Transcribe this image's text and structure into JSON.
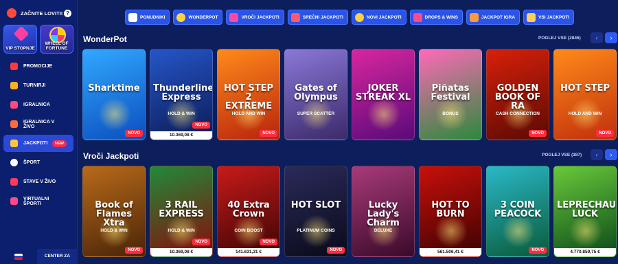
{
  "sidebar": {
    "start_text": "ZAČNITE LOVITI!",
    "promos": [
      {
        "label": "VIP STOPNJE"
      },
      {
        "label": "WHEEL OF FORTUNE"
      }
    ],
    "items": [
      {
        "label": "PROMOCIJE",
        "color": "#ff3a3a"
      },
      {
        "label": "TURNIRJI",
        "color": "#ffb020"
      },
      {
        "label": "IGRALNICA",
        "color": "#ff4a7a"
      },
      {
        "label": "IGRALNICA V ŽIVO",
        "color": "#ff6a3a"
      },
      {
        "label": "JACKPOTI",
        "color": "#ffc83a",
        "badge": "NEW"
      },
      {
        "label": "ŠPORT",
        "color": "#ffffff"
      },
      {
        "label": "STAVE V ŽIVO",
        "color": "#ff3a5a"
      },
      {
        "label": "VIRTUALNI ŠPORTI",
        "color": "#ff4a8a"
      }
    ],
    "center_label": "CENTER ZA"
  },
  "categories": [
    {
      "label": "PONUDNIKI",
      "color": "#ffffff"
    },
    {
      "label": "WONDERPOT",
      "color": "#ffd23a"
    },
    {
      "label": "VROČI JACKPOTI",
      "color": "#ff4aa0"
    },
    {
      "label": "SREČNI JACKPOTI",
      "color": "#ff5a6a"
    },
    {
      "label": "NOVI JACKPOTI",
      "color": "#ffd23a"
    },
    {
      "label": "DROPS & WINS",
      "color": "#ff4a8a"
    },
    {
      "label": "JACKPOT IGRA",
      "color": "#ff9a3a"
    },
    {
      "label": "VSI JACKPOTI",
      "color": "#ffcf5a"
    }
  ],
  "sections": [
    {
      "title": "WonderPot",
      "see_all": "POGLEJ VSE (2846)",
      "games": [
        {
          "title": "Sharktime",
          "bg1": "#31a8ff",
          "bg2": "#0b4fbf",
          "badge": "NOVO"
        },
        {
          "title": "Thunderline Express",
          "sub": "HOLD & WIN",
          "bg1": "#2456c8",
          "bg2": "#0c1b55",
          "badge": "NOVO",
          "jackpot": "10.369,08 €"
        },
        {
          "title": "HOT STEP 2 EXTREME",
          "sub": "HOLD AND WIN",
          "bg1": "#ff8a1a",
          "bg2": "#b8240c",
          "badge": "NOVO"
        },
        {
          "title": "Gates of Olympus",
          "sub": "SUPER SCATTER",
          "bg1": "#8a78d8",
          "bg2": "#3b2a6a"
        },
        {
          "title": "JOKER STREAK XL",
          "bg1": "#d8269e",
          "bg2": "#5a0a7a"
        },
        {
          "title": "Piñatas Festival",
          "sub": "BONUS",
          "bg1": "#ff6ab8",
          "bg2": "#2a8a3a"
        },
        {
          "title": "GOLDEN BOOK OF RA",
          "sub": "CASH CONNECTION",
          "bg1": "#d8200a",
          "bg2": "#5a0a04",
          "badge": "NOVO"
        },
        {
          "title": "HOT STEP",
          "sub": "HOLD AND WIN",
          "bg1": "#ff8a1a",
          "bg2": "#c0300c",
          "badge": "NOVO"
        }
      ]
    },
    {
      "title": "Vroči Jackpoti",
      "see_all": "POGLEJ VSE (387)",
      "games": [
        {
          "title": "Book of Flames Xtra",
          "sub": "HOLD & WIN",
          "bg1": "#b86a1a",
          "bg2": "#4a2408",
          "badge": "NOVO"
        },
        {
          "title": "3 RAIL EXPRESS",
          "sub": "HOLD & WIN",
          "bg1": "#1f8a3a",
          "bg2": "#8a0a0a",
          "badge": "NOVO",
          "jackpot": "10.369,08 €"
        },
        {
          "title": "40 Extra Crown",
          "sub": "COIN BOOST",
          "bg1": "#c81a1a",
          "bg2": "#3a0404",
          "badge": "NOVO",
          "jackpot": "141.631,31 €"
        },
        {
          "title": "HOT SLOT",
          "sub": "PLATINUM COINS",
          "bg1": "#2a2a5a",
          "bg2": "#0a0a1a",
          "badge": "NOVO"
        },
        {
          "title": "Lucky Lady's Charm",
          "sub": "DELUXE",
          "bg1": "#a83a7a",
          "bg2": "#3a0a2a"
        },
        {
          "title": "HOT TO BURN",
          "bg1": "#c8100a",
          "bg2": "#3a0202",
          "jackpot": "561.506,41 €"
        },
        {
          "title": "3 COIN PEACOCK",
          "bg1": "#2ab8c8",
          "bg2": "#0a5a3a",
          "badge": "NOVO"
        },
        {
          "title": "LEPRECHAUN'S LUCK",
          "bg1": "#6ac83a",
          "bg2": "#0a4a1a",
          "jackpot": "4.770.859,75 €"
        }
      ]
    }
  ]
}
